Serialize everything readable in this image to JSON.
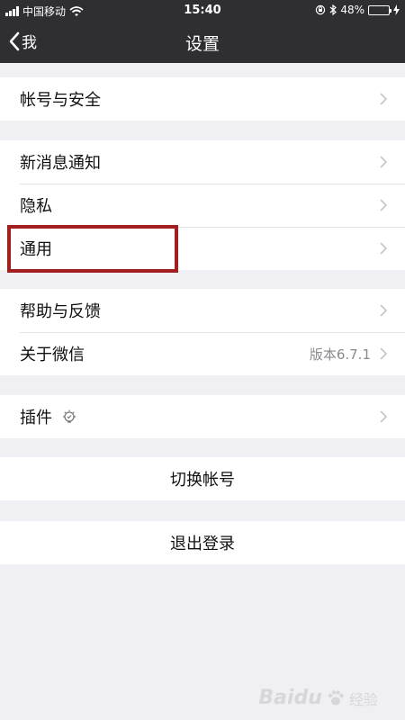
{
  "status_bar": {
    "carrier": "中国移动",
    "time": "15:40",
    "battery_percent": "48%"
  },
  "nav": {
    "back_label": "我",
    "title": "设置"
  },
  "groups": [
    {
      "items": [
        {
          "label": "帐号与安全"
        }
      ]
    },
    {
      "items": [
        {
          "label": "新消息通知"
        },
        {
          "label": "隐私"
        },
        {
          "label": "通用"
        }
      ]
    },
    {
      "items": [
        {
          "label": "帮助与反馈"
        },
        {
          "label": "关于微信",
          "value": "版本6.7.1"
        }
      ]
    },
    {
      "items": [
        {
          "label": "插件"
        }
      ]
    }
  ],
  "actions": {
    "switch_account": "切换帐号",
    "logout": "退出登录"
  },
  "highlight_target": "通用",
  "watermark": {
    "brand": "Baidu",
    "sub": "经验"
  },
  "colors": {
    "bar_bg": "#2e2e33",
    "page_bg": "#efeff4",
    "highlight_border": "#a21f1f",
    "battery_fill": "#4cd964"
  }
}
